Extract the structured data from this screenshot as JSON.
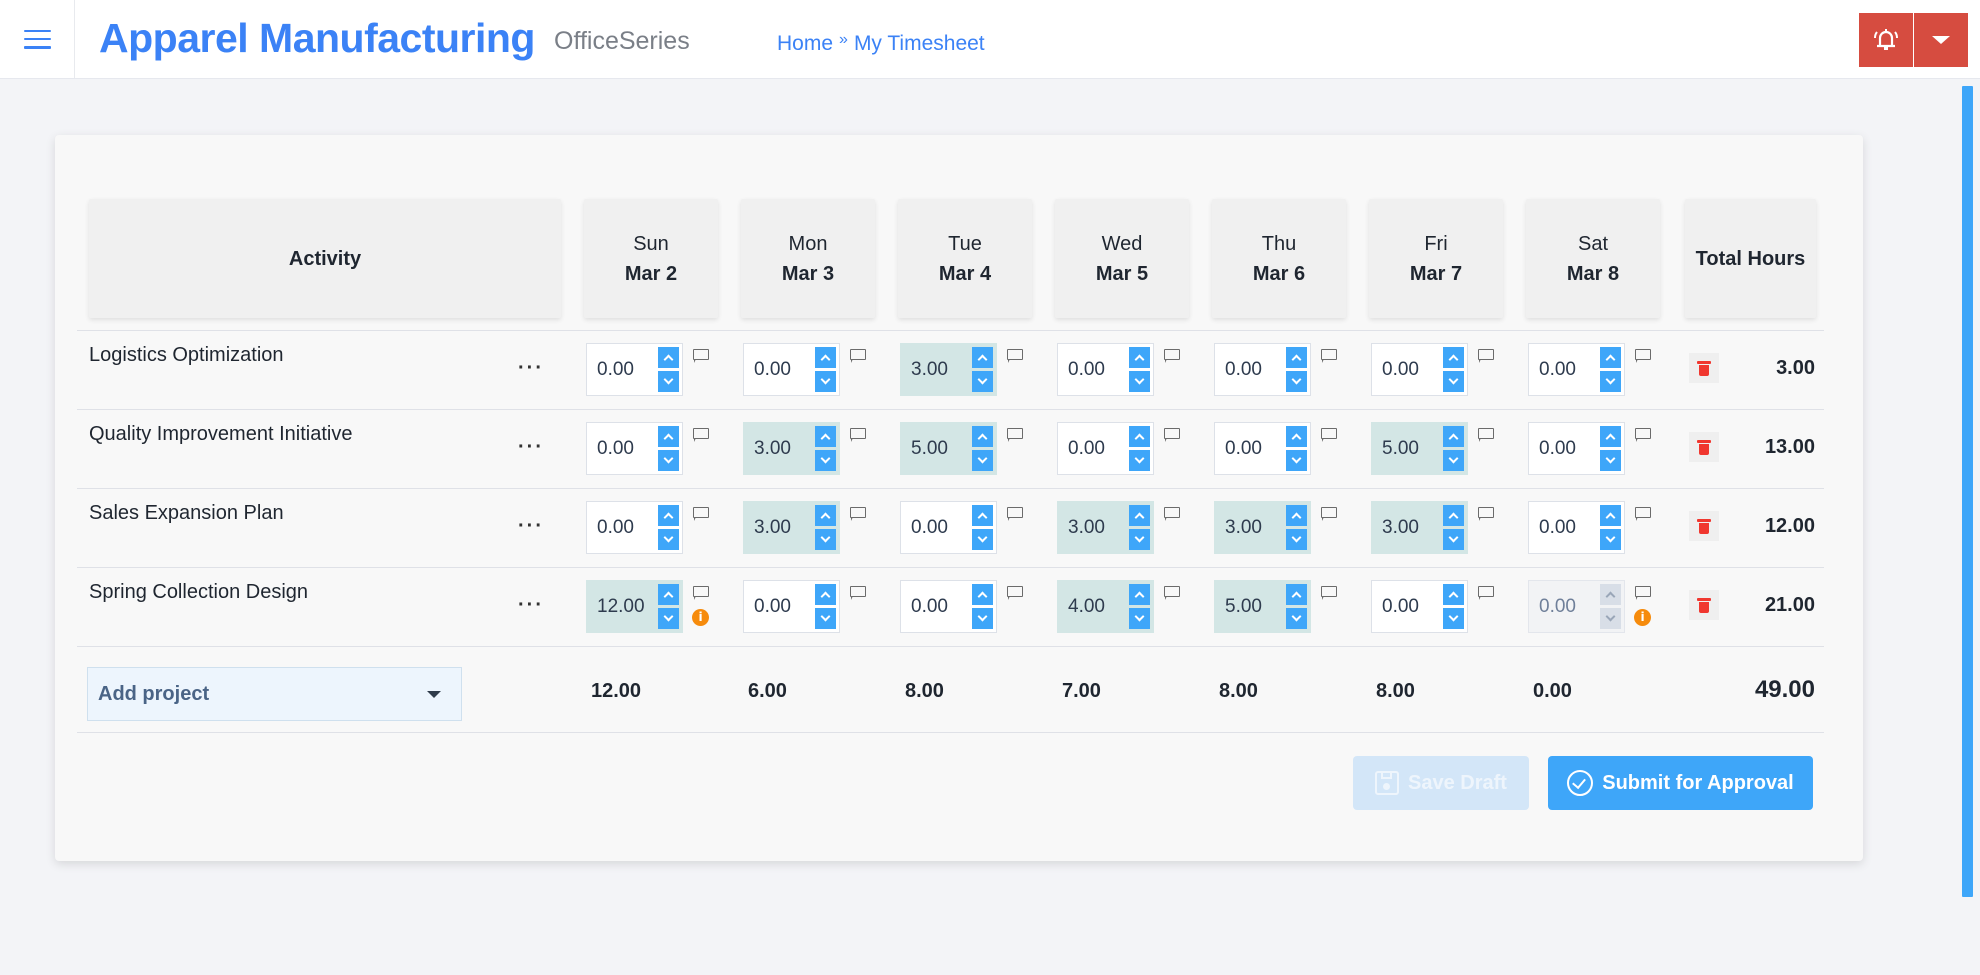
{
  "app": {
    "title": "Apparel Manufacturing",
    "suite": "OfficeSeries",
    "menu_icon": "hamburger-menu-icon",
    "alert_icon": "bell-ringing-icon",
    "alert_dropdown_icon": "caret-down-icon",
    "colors": {
      "brand": "#3b82f6",
      "alert": "#d64c40",
      "accent": "#3ea6f9",
      "filled_cell": "#d3e6e5",
      "danger": "#f0372f",
      "warning": "#f68b0c"
    }
  },
  "breadcrumb": [
    {
      "label": "Home"
    },
    {
      "label": "My Timesheet"
    }
  ],
  "breadcrumb_separator": "»",
  "timesheet": {
    "activity_header": "Activity",
    "total_header": "Total Hours",
    "days": [
      {
        "day": "Sun",
        "date": "Mar 2"
      },
      {
        "day": "Mon",
        "date": "Mar 3"
      },
      {
        "day": "Tue",
        "date": "Mar 4"
      },
      {
        "day": "Wed",
        "date": "Mar 5"
      },
      {
        "day": "Thu",
        "date": "Mar 6"
      },
      {
        "day": "Fri",
        "date": "Mar 7"
      },
      {
        "day": "Sat",
        "date": "Mar 8"
      }
    ],
    "rows": [
      {
        "activity": "Logistics Optimization",
        "menu": "···",
        "hours": [
          "0.00",
          "0.00",
          "3.00",
          "0.00",
          "0.00",
          "0.00",
          "0.00"
        ],
        "total": "3.00",
        "warnings": [
          false,
          false,
          false,
          false,
          false,
          false,
          false
        ],
        "disabled": [
          false,
          false,
          false,
          false,
          false,
          false,
          false
        ]
      },
      {
        "activity": "Quality Improvement Initiative",
        "menu": "···",
        "hours": [
          "0.00",
          "3.00",
          "5.00",
          "0.00",
          "0.00",
          "5.00",
          "0.00"
        ],
        "total": "13.00",
        "warnings": [
          false,
          false,
          false,
          false,
          false,
          false,
          false
        ],
        "disabled": [
          false,
          false,
          false,
          false,
          false,
          false,
          false
        ]
      },
      {
        "activity": "Sales Expansion Plan",
        "menu": "···",
        "hours": [
          "0.00",
          "3.00",
          "0.00",
          "3.00",
          "3.00",
          "3.00",
          "0.00"
        ],
        "total": "12.00",
        "warnings": [
          false,
          false,
          false,
          false,
          false,
          false,
          false
        ],
        "disabled": [
          false,
          false,
          false,
          false,
          false,
          false,
          false
        ]
      },
      {
        "activity": "Spring Collection Design",
        "menu": "···",
        "hours": [
          "12.00",
          "0.00",
          "0.00",
          "4.00",
          "5.00",
          "0.00",
          "0.00"
        ],
        "total": "21.00",
        "warnings": [
          true,
          false,
          false,
          false,
          false,
          false,
          true
        ],
        "disabled": [
          false,
          false,
          false,
          false,
          false,
          false,
          true
        ]
      }
    ],
    "day_totals": [
      "12.00",
      "6.00",
      "8.00",
      "7.00",
      "8.00",
      "8.00",
      "0.00"
    ],
    "grand_total": "49.00",
    "add_project_label": "Add project",
    "info_glyph": "i"
  },
  "actions": {
    "save_draft": "Save Draft",
    "save_draft_icon": "floppy-disk-icon",
    "save_draft_disabled": true,
    "submit": "Submit for Approval",
    "submit_icon": "check-circle-icon"
  }
}
